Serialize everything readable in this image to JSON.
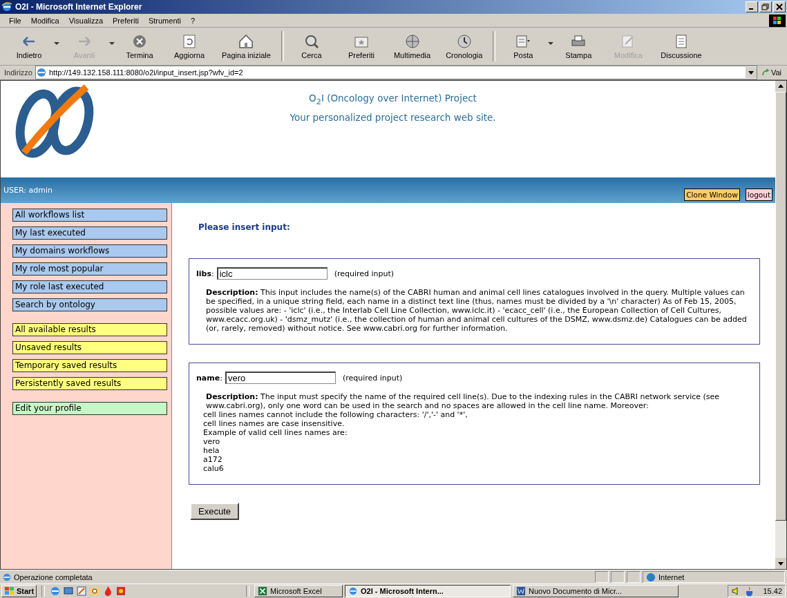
{
  "window": {
    "title": "O2I - Microsoft Internet Explorer"
  },
  "menu": [
    "File",
    "Modifica",
    "Visualizza",
    "Preferiti",
    "Strumenti",
    "?"
  ],
  "toolbar": [
    {
      "label": "Indietro",
      "disabled": false,
      "dropdown": true
    },
    {
      "label": "Avanti",
      "disabled": true,
      "dropdown": true
    },
    {
      "label": "Termina",
      "disabled": false,
      "dropdown": false
    },
    {
      "label": "Aggiorna",
      "disabled": false,
      "dropdown": false
    },
    {
      "label": "Pagina iniziale",
      "disabled": false,
      "dropdown": false
    },
    {
      "label": "Cerca",
      "disabled": false,
      "dropdown": false
    },
    {
      "label": "Preferiti",
      "disabled": false,
      "dropdown": false
    },
    {
      "label": "Multimedia",
      "disabled": false,
      "dropdown": false
    },
    {
      "label": "Cronologia",
      "disabled": false,
      "dropdown": false
    },
    {
      "label": "Posta",
      "disabled": false,
      "dropdown": true
    },
    {
      "label": "Stampa",
      "disabled": false,
      "dropdown": false
    },
    {
      "label": "Modifica",
      "disabled": true,
      "dropdown": false
    },
    {
      "label": "Discussione",
      "disabled": false,
      "dropdown": false
    }
  ],
  "address": {
    "label": "Indirizzo",
    "url": "http://149.132.158.111:8080/o2i/input_insert.jsp?wfv_id=2",
    "go": "Vai"
  },
  "page": {
    "header": {
      "title": "O$_{2}$I (Oncology over Internet) Project",
      "subtitle": "Your personalized project research web site."
    },
    "user_bar": {
      "user": "USER: admin",
      "buttons": [
        {
          "label": "Clone Window",
          "kind": "clone"
        },
        {
          "label": "logout",
          "kind": "logout"
        }
      ]
    },
    "sidebar": {
      "groups": [
        {
          "kind": "workflows",
          "items": [
            "All workflows list",
            "My last executed",
            "My domains workflows",
            "My role most popular",
            "My role last executed",
            "Search by ontology"
          ]
        },
        {
          "kind": "results",
          "items": [
            "All available results",
            "Unsaved results",
            "Temporary saved results",
            "Persistently saved results"
          ]
        },
        {
          "kind": "profile",
          "items": [
            "Edit your profile"
          ]
        }
      ]
    },
    "heading": "Please insert input:",
    "inputs": [
      {
        "label": "**libs**:",
        "value": "iclc",
        "note": "(required input)",
        "description": "**Description:** This input includes the name(s) of the CABRI human and animal cell lines catalogues involved in the query. Multiple values can be specified, in a unique string field, each name in a distinct text line (thus, names must be divided by a '\\n' character) As of Feb 15, 2005, possible values are: - 'iclc' (i.e., the Interlab Cell Line Collection, www.iclc.it) - 'ecacc_cell' (i.e., the European Collection of Cell Cultures, www.ecacc.org.uk) - 'dsmz_mutz' (i.e., the collection of human and animal cell cultures of the DSMZ, www.dsmz.de) Catalogues can be added (or, rarely, removed) without notice. See www.cabri.org for further information."
      },
      {
        "label": "**name**:",
        "value": "vero",
        "note": "(required input)",
        "description": "**Description:** The input must specify the name of the required cell line(s). Due to the indexing rules in the CABRI network service (see www.cabri.org), only one word can be used in the search and no spaces are allowed in the cell line name. Moreover:",
        "extra_lines": [
          "cell lines names cannot include the following characters: '/','-' and '*',",
          "cell lines names are case insensitive.",
          "Example of valid cell lines names are:",
          "vero",
          "hela",
          "a172",
          "calu6"
        ]
      }
    ],
    "execute": "Execute"
  },
  "status_bar": {
    "text": "Operazione completata",
    "zone": "Internet"
  },
  "taskbar": {
    "start": "Start",
    "tasks": [
      {
        "label": "Microsoft Excel",
        "selected": false
      },
      {
        "label": "O2I - Microsoft Intern...",
        "selected": true
      },
      {
        "label": "Nuovo Documento di Micr...",
        "selected": false
      }
    ],
    "clock": "15.42"
  }
}
